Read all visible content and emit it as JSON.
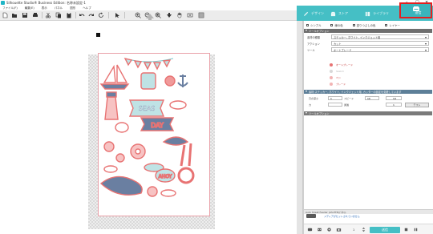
{
  "window": {
    "title": "Silhouette Studio® Business Edition: 名称未設定-1",
    "controls": [
      "–",
      "□",
      "✕"
    ]
  },
  "menu": [
    "ファイル(F)",
    "編集(E)",
    "表示",
    "パネル",
    "図形",
    "ヘルプ"
  ],
  "panel_tabs": [
    {
      "label": "デザイン",
      "icon": "design-icon"
    },
    {
      "label": "ストア",
      "icon": "store-icon"
    },
    {
      "label": "ライブラリ",
      "icon": "library-icon"
    },
    {
      "label": "送信",
      "icon": "send-icon",
      "active": true
    }
  ],
  "modes": [
    "シンプル",
    "線の色",
    "塗りつぶしの色",
    "レイヤー"
  ],
  "sections": {
    "tool_options": "ツールオプション",
    "material_settings": "素材:ステッカー, ホワイト, インクジェット用, カッターの設定を変更しています",
    "tool_options_2": "ツールオプション"
  },
  "fields": {
    "material_label": "素材の種類",
    "material_value": "ステッカー, ホワイト, インクジェット用",
    "action_label": "アクション",
    "action_value": "カット",
    "tool_label": "ツール",
    "tool_value": "オートブレード"
  },
  "tools": [
    {
      "name": "AutoBlade",
      "label": "オートブレード",
      "color": "#e87373",
      "dim": false
    },
    {
      "name": "Sketch",
      "label": "Sketch",
      "color": "#d8d8d8",
      "dim": true
    },
    {
      "name": "Pen",
      "label": "ペン",
      "color": "#f2b3b3",
      "dim": false
    },
    {
      "name": "Blade",
      "label": "ブレード",
      "color": "#f2b3b3",
      "dim": false
    }
  ],
  "adjust": {
    "pressure_label": "刃の深さ",
    "pressure_value": "1",
    "speed_label": "スピード",
    "speed_value": "10",
    "force_label": "力",
    "force_value": "14",
    "passes_label": "通過",
    "passes_value": "1",
    "test_button": "テスト"
  },
  "status": {
    "line1": "Auto Sheet Feeder (AS-PTB)パネル",
    "line2": "メディアがセットされていません"
  },
  "bottom": {
    "copies": "1",
    "send_button": "送信"
  },
  "colors": {
    "accent": "#45bfc5",
    "highlight": "#e32020",
    "cut_line": "#e9a0a8"
  }
}
